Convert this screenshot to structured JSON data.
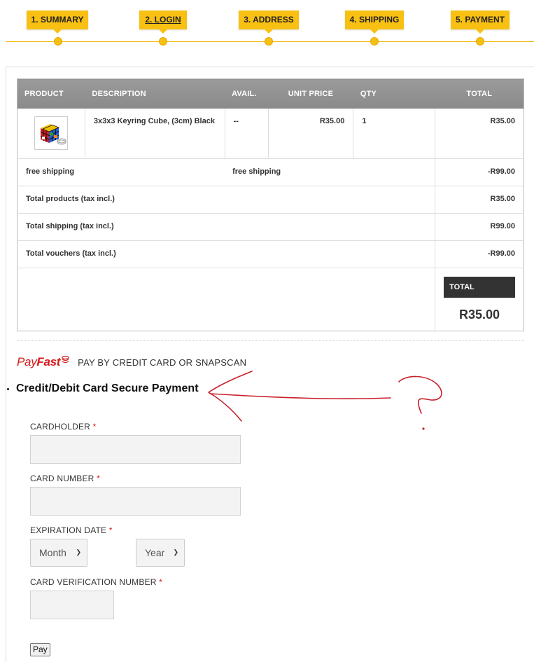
{
  "steps": [
    {
      "label": "1. SUMMARY"
    },
    {
      "label": "2. LOGIN"
    },
    {
      "label": "3. ADDRESS"
    },
    {
      "label": "4. SHIPPING"
    },
    {
      "label": "5. PAYMENT"
    }
  ],
  "cart": {
    "headers": {
      "product": "PRODUCT",
      "description": "DESCRIPTION",
      "avail": "AVAIL.",
      "unit_price": "UNIT PRICE",
      "qty": "QTY",
      "total": "TOTAL"
    },
    "item": {
      "description": "3x3x3 Keyring Cube, (3cm) Black",
      "avail": "--",
      "unit_price": "R35.00",
      "qty": "1",
      "total": "R35.00"
    },
    "shipping_row": {
      "label": "free shipping",
      "description": "free shipping",
      "amount": "-R99.00"
    },
    "summary": [
      {
        "label": "Total products (tax incl.)",
        "value": "R35.00"
      },
      {
        "label": "Total shipping (tax incl.)",
        "value": "R99.00"
      },
      {
        "label": "Total vouchers (tax incl.)",
        "value": "-R99.00"
      }
    ],
    "grand_total": {
      "label": "TOTAL",
      "value": "R35.00"
    }
  },
  "payment": {
    "provider_logo_a": "Pay",
    "provider_logo_b": "Fast",
    "provider_text": "PAY BY CREDIT CARD OR SNAPSCAN",
    "heading": "Credit/Debit Card Secure Payment",
    "cardholder_label": "CARDHOLDER",
    "card_number_label": "CARD NUMBER",
    "expiration_label": "EXPIRATION DATE",
    "month_value": "Month",
    "year_value": "Year",
    "cvn_label": "CARD VERIFICATION NUMBER",
    "required_mark": "*",
    "pay_button": "Pay"
  },
  "colors": {
    "step_yellow": "#f8c012",
    "header_gray": "#8f8f8f",
    "total_dark": "#333333",
    "payfast_red": "#d41b1b",
    "annotation_red": "#c8202a"
  }
}
